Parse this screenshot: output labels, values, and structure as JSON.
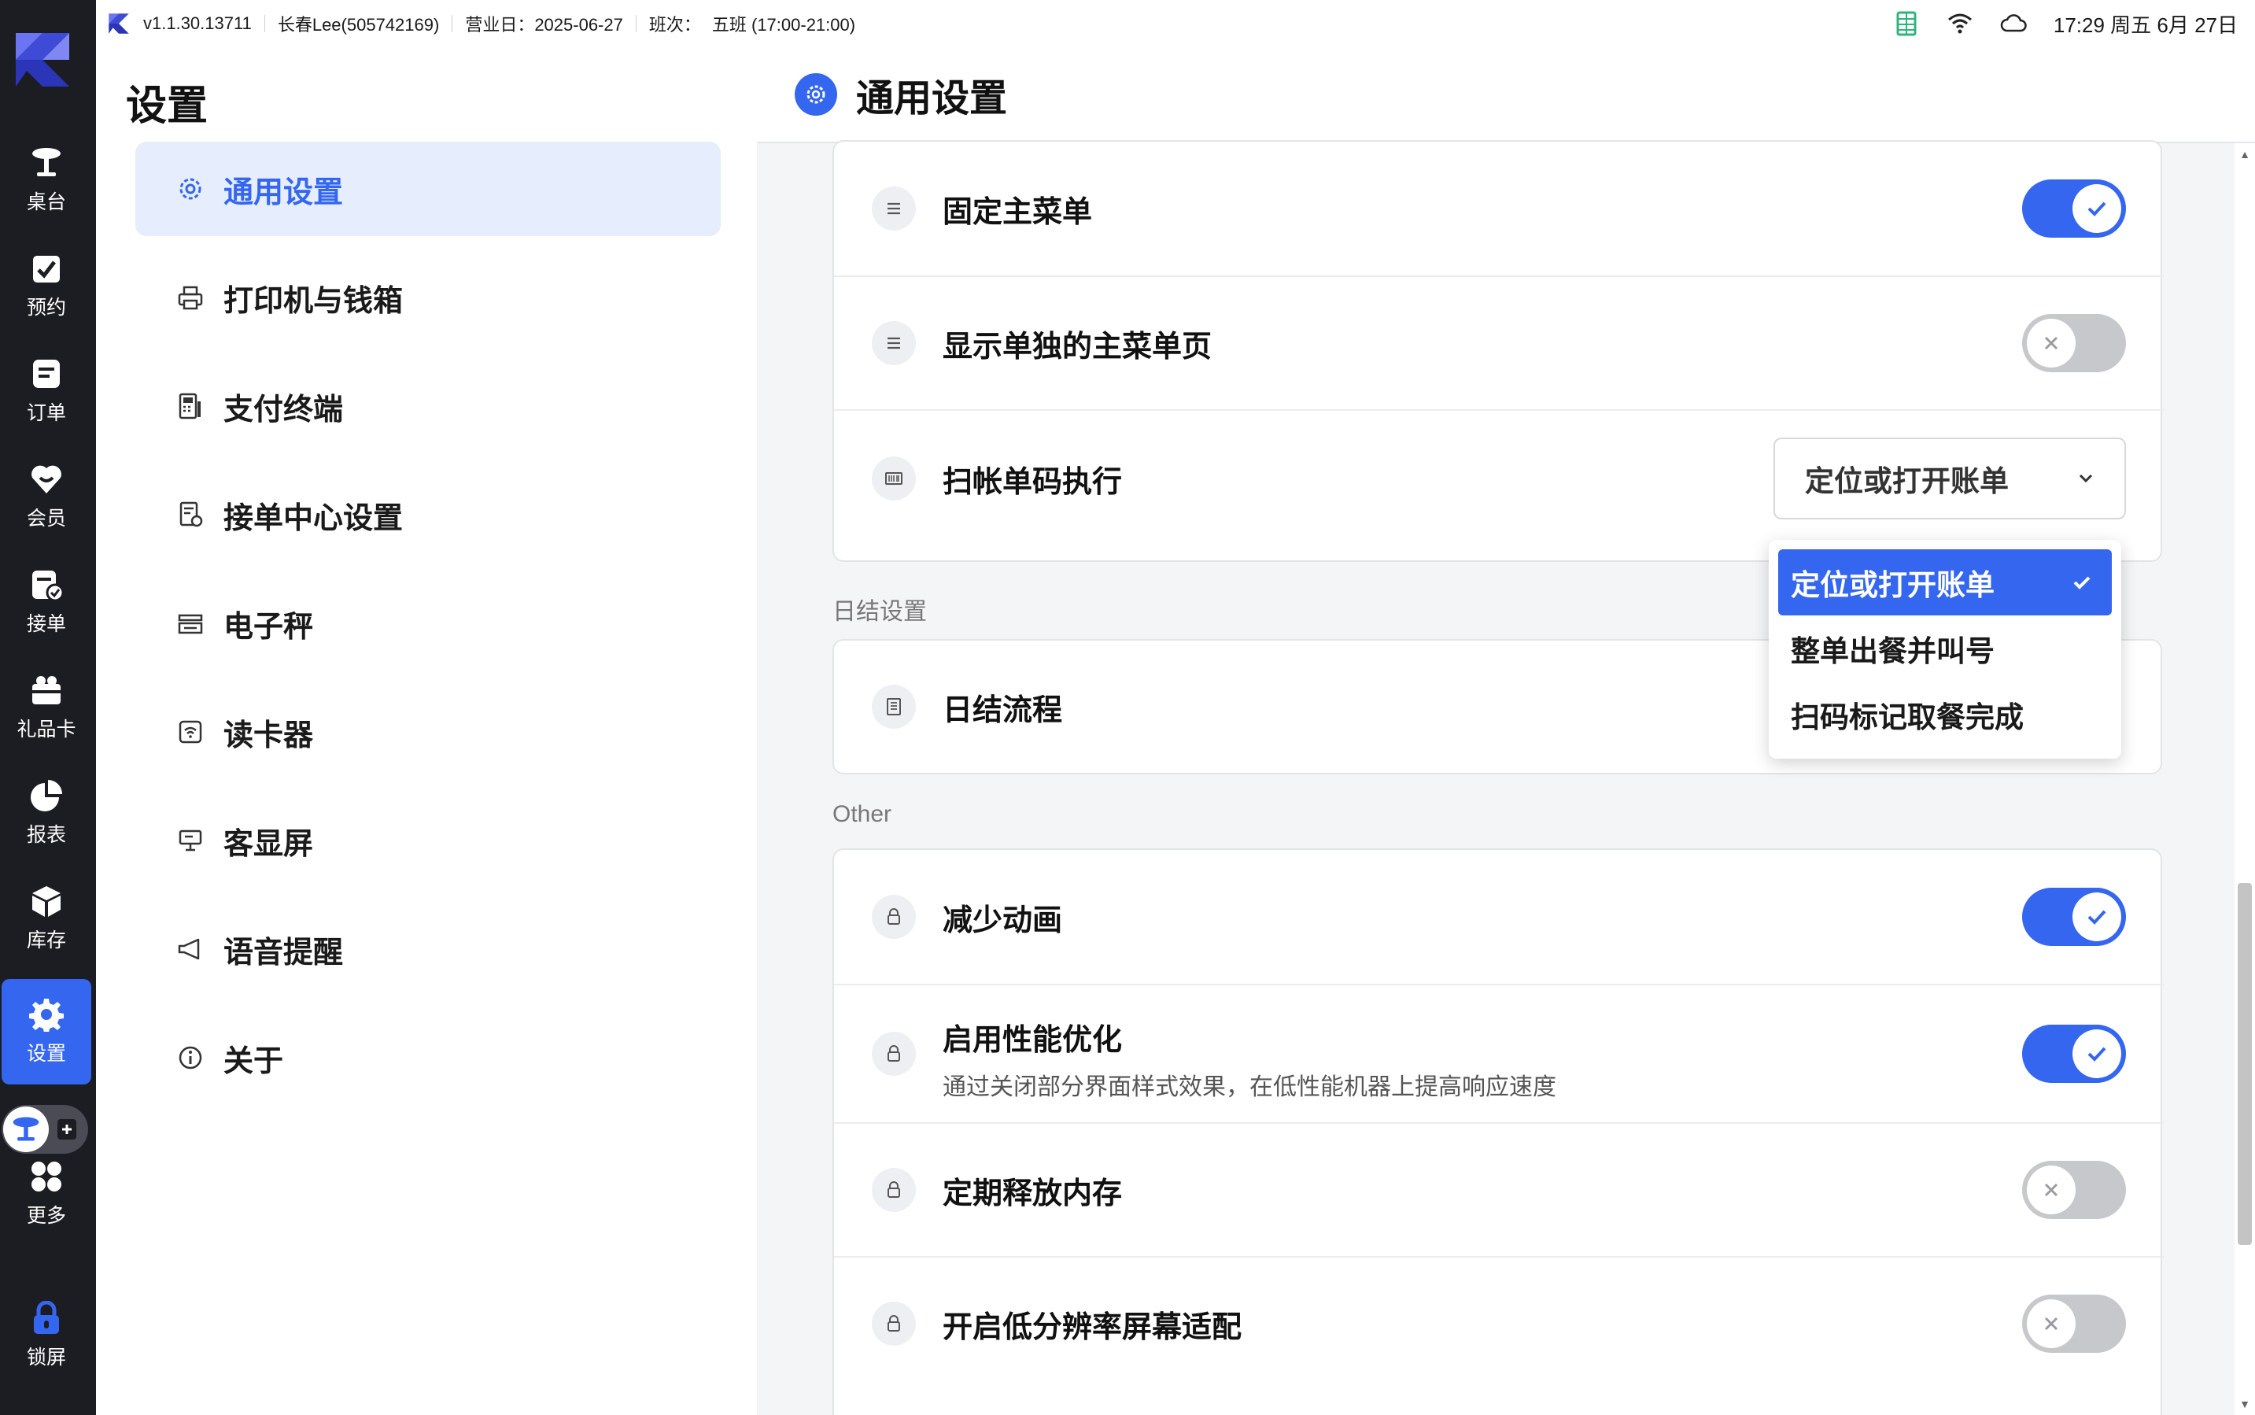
{
  "status_bar": {
    "version": "v1.1.30.13711",
    "user": "长春Lee(505742169)",
    "business_day": "营业日：2025-06-27",
    "shift_label": "班次：",
    "shift_value": "五班 (17:00-21:00)",
    "clock": "17:29 周五 6月 27日",
    "icons": [
      "spreadsheet-icon",
      "wifi-icon",
      "cloud-icon"
    ]
  },
  "rail": {
    "items": [
      {
        "label": "桌台",
        "icon": "table-icon"
      },
      {
        "label": "预约",
        "icon": "reservation-icon"
      },
      {
        "label": "订单",
        "icon": "order-icon"
      },
      {
        "label": "会员",
        "icon": "member-icon"
      },
      {
        "label": "接单",
        "icon": "accept-order-icon"
      },
      {
        "label": "礼品卡",
        "icon": "gift-card-icon"
      },
      {
        "label": "报表",
        "icon": "report-icon"
      },
      {
        "label": "库存",
        "icon": "inventory-icon"
      },
      {
        "label": "设置",
        "icon": "settings-icon"
      },
      {
        "label": "更多",
        "icon": "more-icon"
      },
      {
        "label": "锁屏",
        "icon": "lock-icon"
      }
    ],
    "active": "设置"
  },
  "nav": {
    "title": "设置",
    "items": [
      {
        "label": "通用设置",
        "icon": "gear-icon"
      },
      {
        "label": "打印机与钱箱",
        "icon": "printer-icon"
      },
      {
        "label": "支付终端",
        "icon": "pos-terminal-icon"
      },
      {
        "label": "接单中心设置",
        "icon": "order-center-icon"
      },
      {
        "label": "电子秤",
        "icon": "scale-icon"
      },
      {
        "label": "读卡器",
        "icon": "card-reader-icon"
      },
      {
        "label": "客显屏",
        "icon": "customer-display-icon"
      },
      {
        "label": "语音提醒",
        "icon": "megaphone-icon"
      },
      {
        "label": "关于",
        "icon": "info-icon"
      }
    ],
    "active": "通用设置"
  },
  "main": {
    "title": "通用设置",
    "rows_top": [
      {
        "label": "固定主菜单",
        "toggle": true,
        "icon": "menu-lines-icon"
      },
      {
        "label": "显示单独的主菜单页",
        "toggle": false,
        "icon": "menu-lines-icon"
      },
      {
        "label": "扫帐单码执行",
        "select_value": "定位或打开账单",
        "icon": "barcode-icon"
      }
    ],
    "section_daily": "日结设置",
    "rows_daily": [
      {
        "label": "日结流程",
        "icon": "list-icon"
      }
    ],
    "section_other": "Other",
    "rows_other": [
      {
        "label": "减少动画",
        "toggle": true,
        "icon": "lock-small-icon"
      },
      {
        "label": "启用性能优化",
        "sub": "通过关闭部分界面样式效果，在低性能机器上提高响应速度",
        "toggle": true,
        "icon": "lock-small-icon"
      },
      {
        "label": "定期释放内存",
        "toggle": false,
        "icon": "lock-small-icon"
      },
      {
        "label": "开启低分辨率屏幕适配",
        "toggle": false,
        "icon": "lock-small-icon"
      }
    ],
    "dropdown_options": [
      "定位或打开账单",
      "整单出餐并叫号",
      "扫码标记取餐完成"
    ],
    "dropdown_selected": "定位或打开账单"
  },
  "colors": {
    "accent": "#3466f0",
    "rail_bg": "#1c1d22",
    "toggle_off": "#c7c8cc"
  }
}
